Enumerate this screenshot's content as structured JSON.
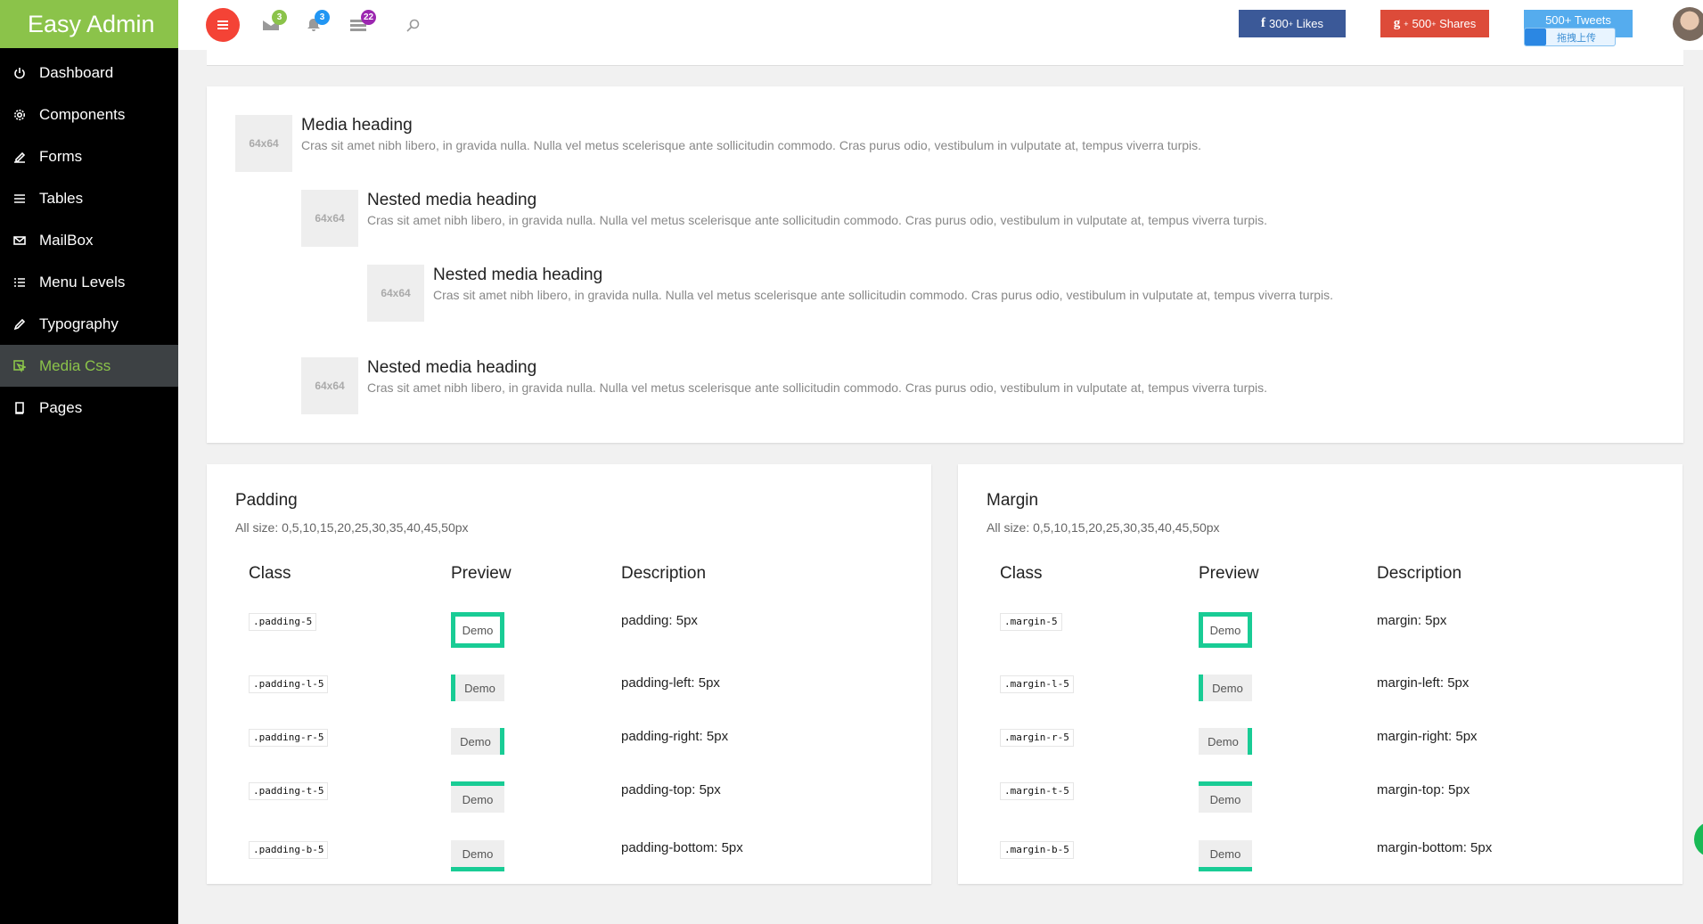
{
  "brand": "Easy Admin",
  "sidebar": {
    "items": [
      {
        "label": "Dashboard",
        "icon": "power-icon"
      },
      {
        "label": "Components",
        "icon": "gear-icon"
      },
      {
        "label": "Forms",
        "icon": "edit-icon"
      },
      {
        "label": "Tables",
        "icon": "list-icon"
      },
      {
        "label": "MailBox",
        "icon": "mail-icon"
      },
      {
        "label": "Menu Levels",
        "icon": "menu-levels-icon"
      },
      {
        "label": "Typography",
        "icon": "pencil-icon"
      },
      {
        "label": "Media Css",
        "icon": "media-icon",
        "active": true
      },
      {
        "label": "Pages",
        "icon": "book-icon"
      }
    ]
  },
  "topbar": {
    "mail_count": "3",
    "notification_count": "3",
    "messages_count": "22",
    "facebook": {
      "count": "300",
      "sup": "+",
      "label": "Likes",
      "glyph": "f"
    },
    "google": {
      "count": "500",
      "sup": "+",
      "label": "Shares",
      "glyph": "g"
    },
    "twitter": {
      "label": "500+ Tweets"
    },
    "upload_tag": "拖拽上传",
    "colors": {
      "facebook": "#3b5998",
      "google": "#dd4b39",
      "twitter": "#55acee",
      "menu": "#f44336",
      "badge_green": "#8bc34a",
      "badge_blue": "#2196f3",
      "badge_purple": "#9c27b0"
    }
  },
  "media": {
    "placeholder": "64x64",
    "text": "Cras sit amet nibh libero, in gravida nulla. Nulla vel metus scelerisque ante sollicitudin commodo. Cras purus odio, vestibulum in vulputate at, tempus viverra turpis.",
    "items": [
      {
        "heading": "Media heading"
      },
      {
        "heading": "Nested media heading"
      },
      {
        "heading": "Nested media heading"
      },
      {
        "heading": "Nested media heading"
      }
    ]
  },
  "padding": {
    "title": "Padding",
    "subtitle": "All size: 0,5,10,15,20,25,30,35,40,45,50px",
    "headers": [
      "Class",
      "Preview",
      "Description"
    ],
    "demo_label": "Demo",
    "rows": [
      {
        "cls": ".padding-5",
        "desc": "padding: 5px"
      },
      {
        "cls": ".padding-l-5",
        "desc": "padding-left: 5px"
      },
      {
        "cls": ".padding-r-5",
        "desc": "padding-right: 5px"
      },
      {
        "cls": ".padding-t-5",
        "desc": "padding-top: 5px"
      },
      {
        "cls": ".padding-b-5",
        "desc": "padding-bottom: 5px"
      }
    ]
  },
  "margin": {
    "title": "Margin",
    "subtitle": "All size: 0,5,10,15,20,25,30,35,40,45,50px",
    "headers": [
      "Class",
      "Preview",
      "Description"
    ],
    "demo_label": "Demo",
    "rows": [
      {
        "cls": ".margin-5",
        "desc": "margin: 5px"
      },
      {
        "cls": ".margin-l-5",
        "desc": "margin-left: 5px"
      },
      {
        "cls": ".margin-r-5",
        "desc": "margin-right: 5px"
      },
      {
        "cls": ".margin-t-5",
        "desc": "margin-top: 5px"
      },
      {
        "cls": ".margin-b-5",
        "desc": "margin-bottom: 5px"
      }
    ]
  },
  "accent": "#19cc95"
}
